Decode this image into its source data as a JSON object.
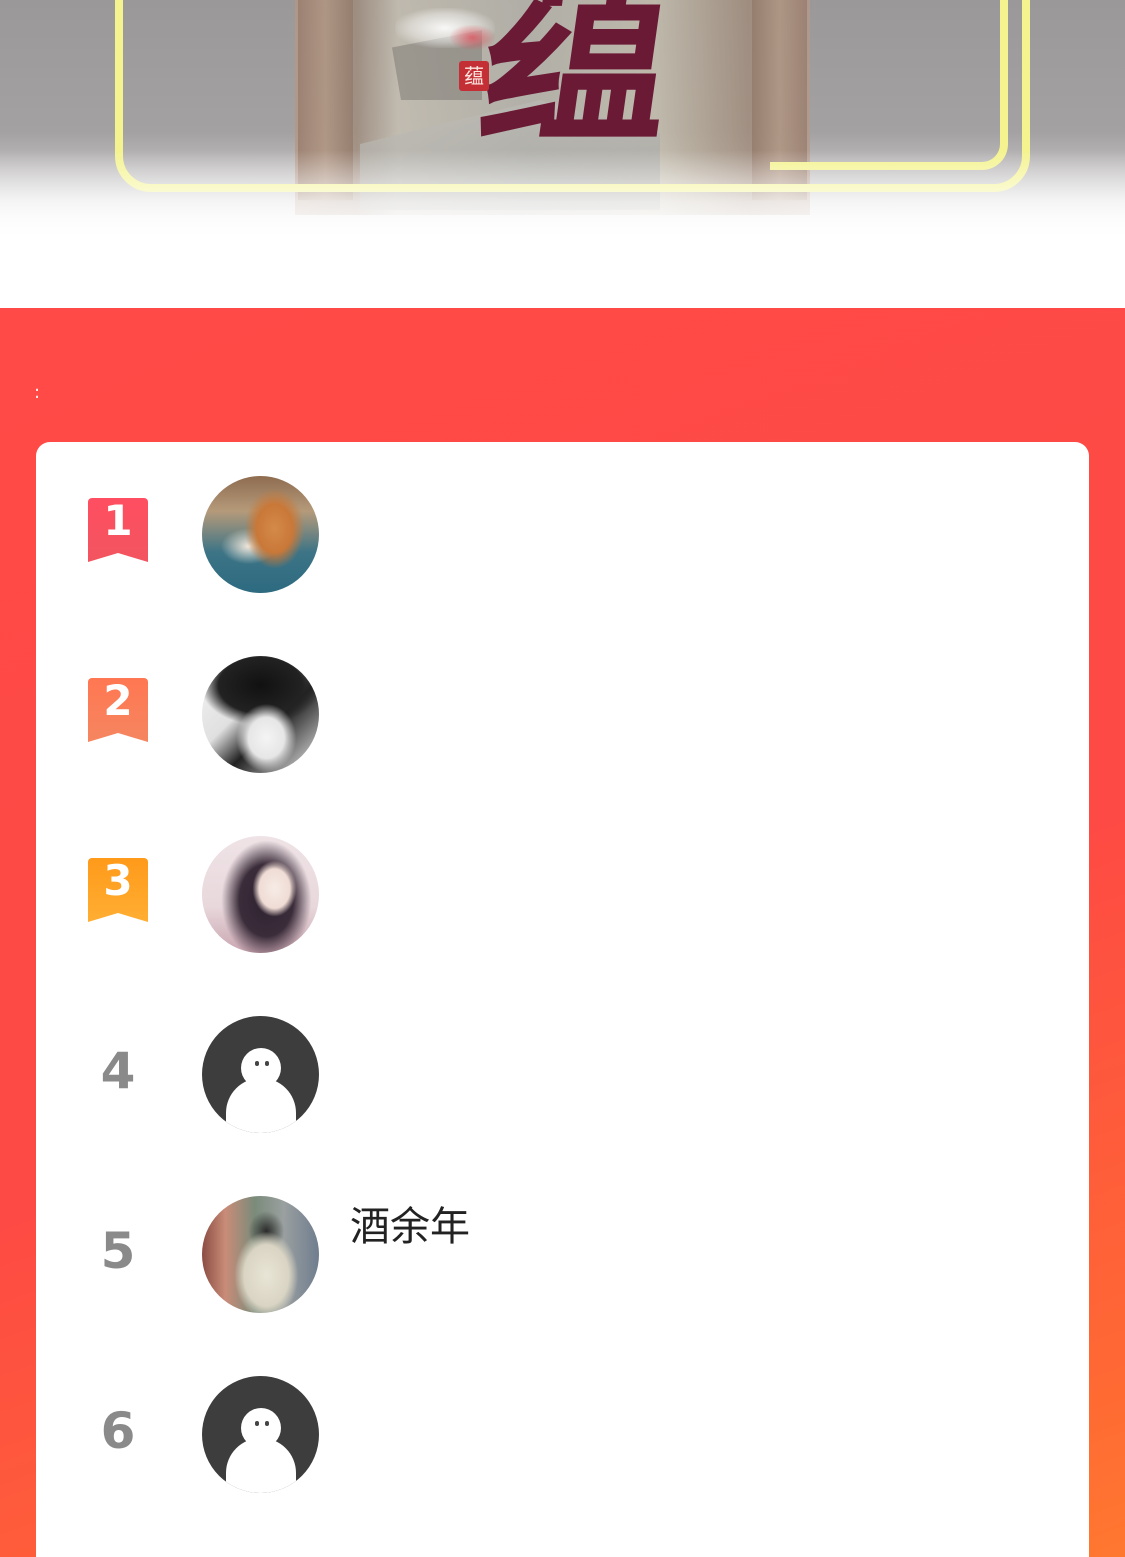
{
  "banner": {
    "title_glyph": "蕴",
    "seal_glyph": "蕴"
  },
  "ranking": {
    "entries": [
      {
        "rank": "1",
        "name": "",
        "avatar": "dog-photo",
        "badge": "ribbon-red"
      },
      {
        "rank": "2",
        "name": "",
        "avatar": "ink-sketch-boy",
        "badge": "ribbon-orange"
      },
      {
        "rank": "3",
        "name": "",
        "avatar": "anime-girl",
        "badge": "ribbon-amber"
      },
      {
        "rank": "4",
        "name": "",
        "avatar": "default-ghost",
        "badge": "none"
      },
      {
        "rank": "5",
        "name": "酒余年",
        "avatar": "anime-boy",
        "badge": "none"
      },
      {
        "rank": "6",
        "name": "",
        "avatar": "default-ghost",
        "badge": "none"
      }
    ]
  },
  "colors": {
    "panel_red": "#fe4a44",
    "panel_orange": "#ff7830",
    "frame_yellow": "#f4f38f",
    "rank1": "#f2555f",
    "rank2": "#f58660",
    "rank3": "#ffae33",
    "rank_gray": "#8a8a8a"
  }
}
